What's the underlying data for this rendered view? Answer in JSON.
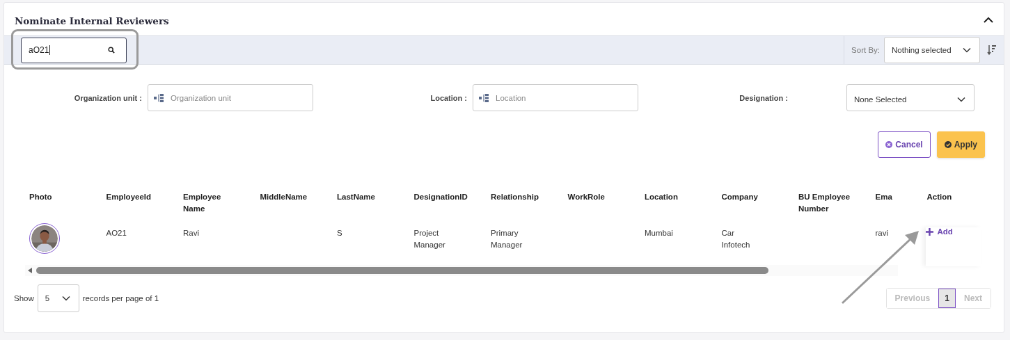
{
  "panel": {
    "title": "Nominate Internal Reviewers",
    "expanded": true
  },
  "search": {
    "value": "aO21"
  },
  "sort": {
    "label": "Sort By:",
    "value": "Nothing selected"
  },
  "filters": [
    {
      "label": "Organization unit :",
      "kind": "tree",
      "placeholder": "Organization unit"
    },
    {
      "label": "Location :",
      "kind": "tree",
      "placeholder": "Location"
    },
    {
      "label": "Designation :",
      "kind": "select",
      "value": "None Selected"
    }
  ],
  "buttons": [
    {
      "label": "Cancel",
      "kind": "cancel"
    },
    {
      "label": "Apply",
      "kind": "apply"
    }
  ],
  "table": {
    "columns": [
      "Photo",
      "EmployeeId",
      "Employee Name",
      "MiddleName",
      "LastName",
      "DesignationID",
      "Relationship",
      "WorkRole",
      "Location",
      "Company",
      "BU Employee Number",
      "Ema",
      "Action"
    ],
    "rows": [
      {
        "cells": [
          {
            "kind": "picture"
          },
          "AO21",
          "Ravi",
          "",
          "S",
          "Project Manager",
          "Primary Manager",
          "",
          "Mumbai",
          "Car Infotech",
          "",
          "ravi",
          {
            "kind": "link",
            "label": "Add"
          }
        ]
      }
    ]
  },
  "footer": {
    "show": "Show",
    "page_size": "5",
    "suffix": "records per page of 1"
  },
  "pagination": [
    {
      "label": "Previous",
      "kind": "nav",
      "disabled": true,
      "selected": false
    },
    {
      "label": "1",
      "kind": "page",
      "disabled": false,
      "selected": true
    },
    {
      "label": "Next",
      "kind": "nav",
      "disabled": true,
      "selected": false
    }
  ]
}
